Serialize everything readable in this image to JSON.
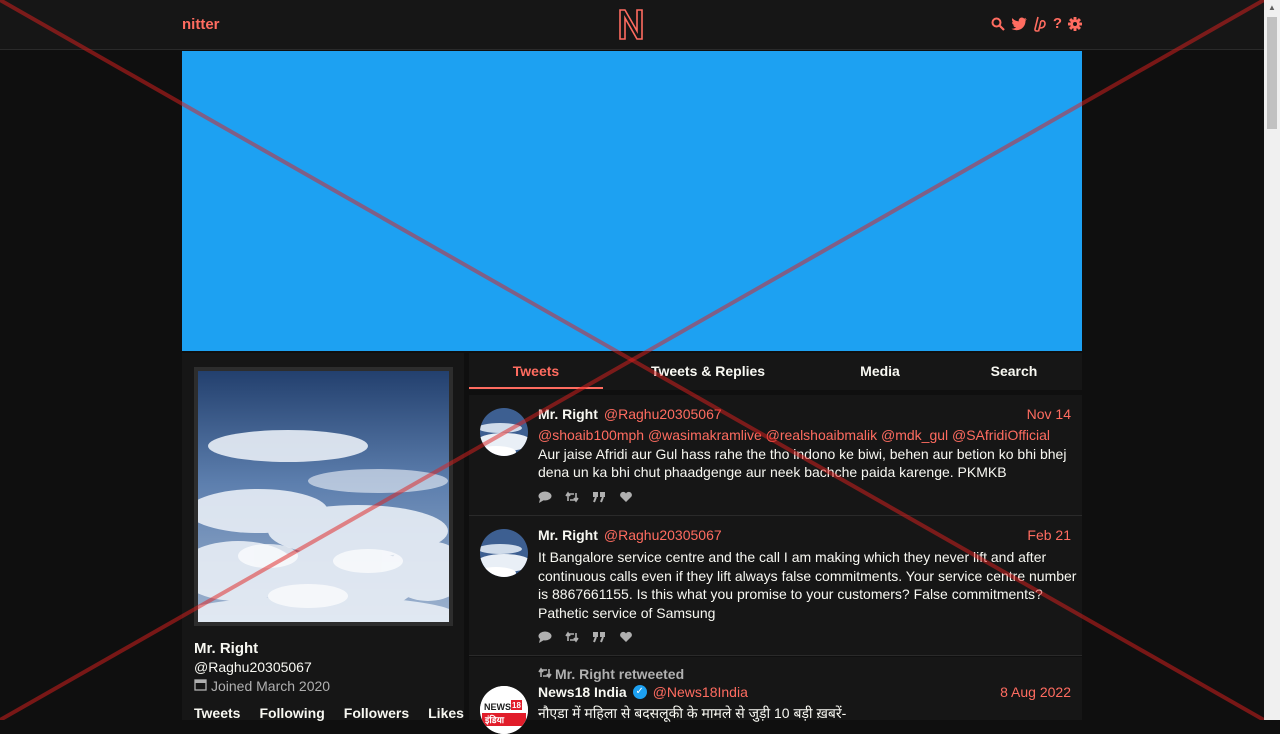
{
  "nav": {
    "brand": "nitter",
    "logo_letter": "N",
    "icons": [
      "search-icon",
      "twitter-bird-icon",
      "liberapay-icon",
      "help-icon",
      "gear-icon"
    ],
    "help_glyph": "?"
  },
  "colors": {
    "accent": "#ff6c60",
    "banner": "#1da1f2",
    "background": "#0f0f0f",
    "panel": "#161616"
  },
  "profile": {
    "fullname": "Mr. Right",
    "username": "@Raghu20305067",
    "joined": "Joined March 2020",
    "stats": [
      "Tweets",
      "Following",
      "Followers",
      "Likes"
    ]
  },
  "tabs": [
    "Tweets",
    "Tweets & Replies",
    "Media",
    "Search"
  ],
  "tweets": [
    {
      "fullname": "Mr. Right",
      "username": "@Raghu20305067",
      "date": "Nov 14",
      "mentions": "@shoaib100mph @wasimakramlive @realshoaibmalik @mdk_gul @SAfridiOfficial",
      "text": "Aur jaise Afridi aur Gul hass rahe the tho indono ke biwi, behen aur betion ko bhi bhej dena un ka bhi chut phaadgenge aur neek bachche paida karenge. PKMKB"
    },
    {
      "fullname": "Mr. Right",
      "username": "@Raghu20305067",
      "date": "Feb 21",
      "text": "It Bangalore service centre and the call I am making which they never lift and after continuous calls even if they lift always false commitments. Your service centre number is 8867661155. Is this what you promise to your customers? False commitments? Pathetic service of Samsung"
    },
    {
      "retweet_header": "Mr. Right retweeted",
      "fullname": "News18 India",
      "username": "@News18India",
      "date": "8 Aug 2022",
      "text": "नौएडा में महिला से बदसलूकी के मामले से जुड़ी 10 बड़ी ख़बरें-",
      "avatar_text": "NEWS",
      "avatar_badge": "18",
      "avatar_subtext": "इंडिया"
    }
  ]
}
